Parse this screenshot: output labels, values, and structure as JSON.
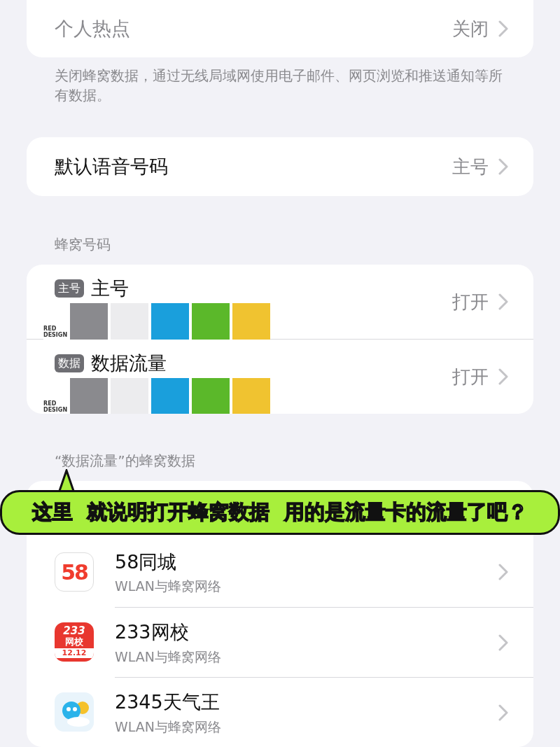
{
  "hotspot": {
    "label": "个人热点",
    "value": "关闭",
    "disabled": true
  },
  "hotspot_footnote": "关闭蜂窝数据，通过无线局域网使用电子邮件、网页浏览和推送通知等所有数据。",
  "voice": {
    "label": "默认语音号码",
    "value": "主号"
  },
  "lines_header": "蜂窝号码",
  "lines": [
    {
      "badge": "主号",
      "name": "主号",
      "value": "打开",
      "sticker": "RED DESIGN"
    },
    {
      "badge": "数据",
      "name": "数据流量",
      "value": "打开",
      "sticker": "RED DESIGN"
    }
  ],
  "apps_header": "“数据流量”的蜂窝数据",
  "apps": [
    {
      "kind": "fiftyeight",
      "icon_text": [
        "58"
      ],
      "name": "58同城",
      "subtitle": "WLAN与蜂窝网络"
    },
    {
      "kind": "school",
      "icon_text": [
        "233",
        "网校",
        "12.12"
      ],
      "name": "233网校",
      "subtitle": "WLAN与蜂窝网络"
    },
    {
      "kind": "weather",
      "name": "2345天气王",
      "subtitle": "WLAN与蜂窝网络"
    }
  ],
  "annotation": "这里  就说明打开蜂窝数据  用的是流量卡的流量了吧？"
}
